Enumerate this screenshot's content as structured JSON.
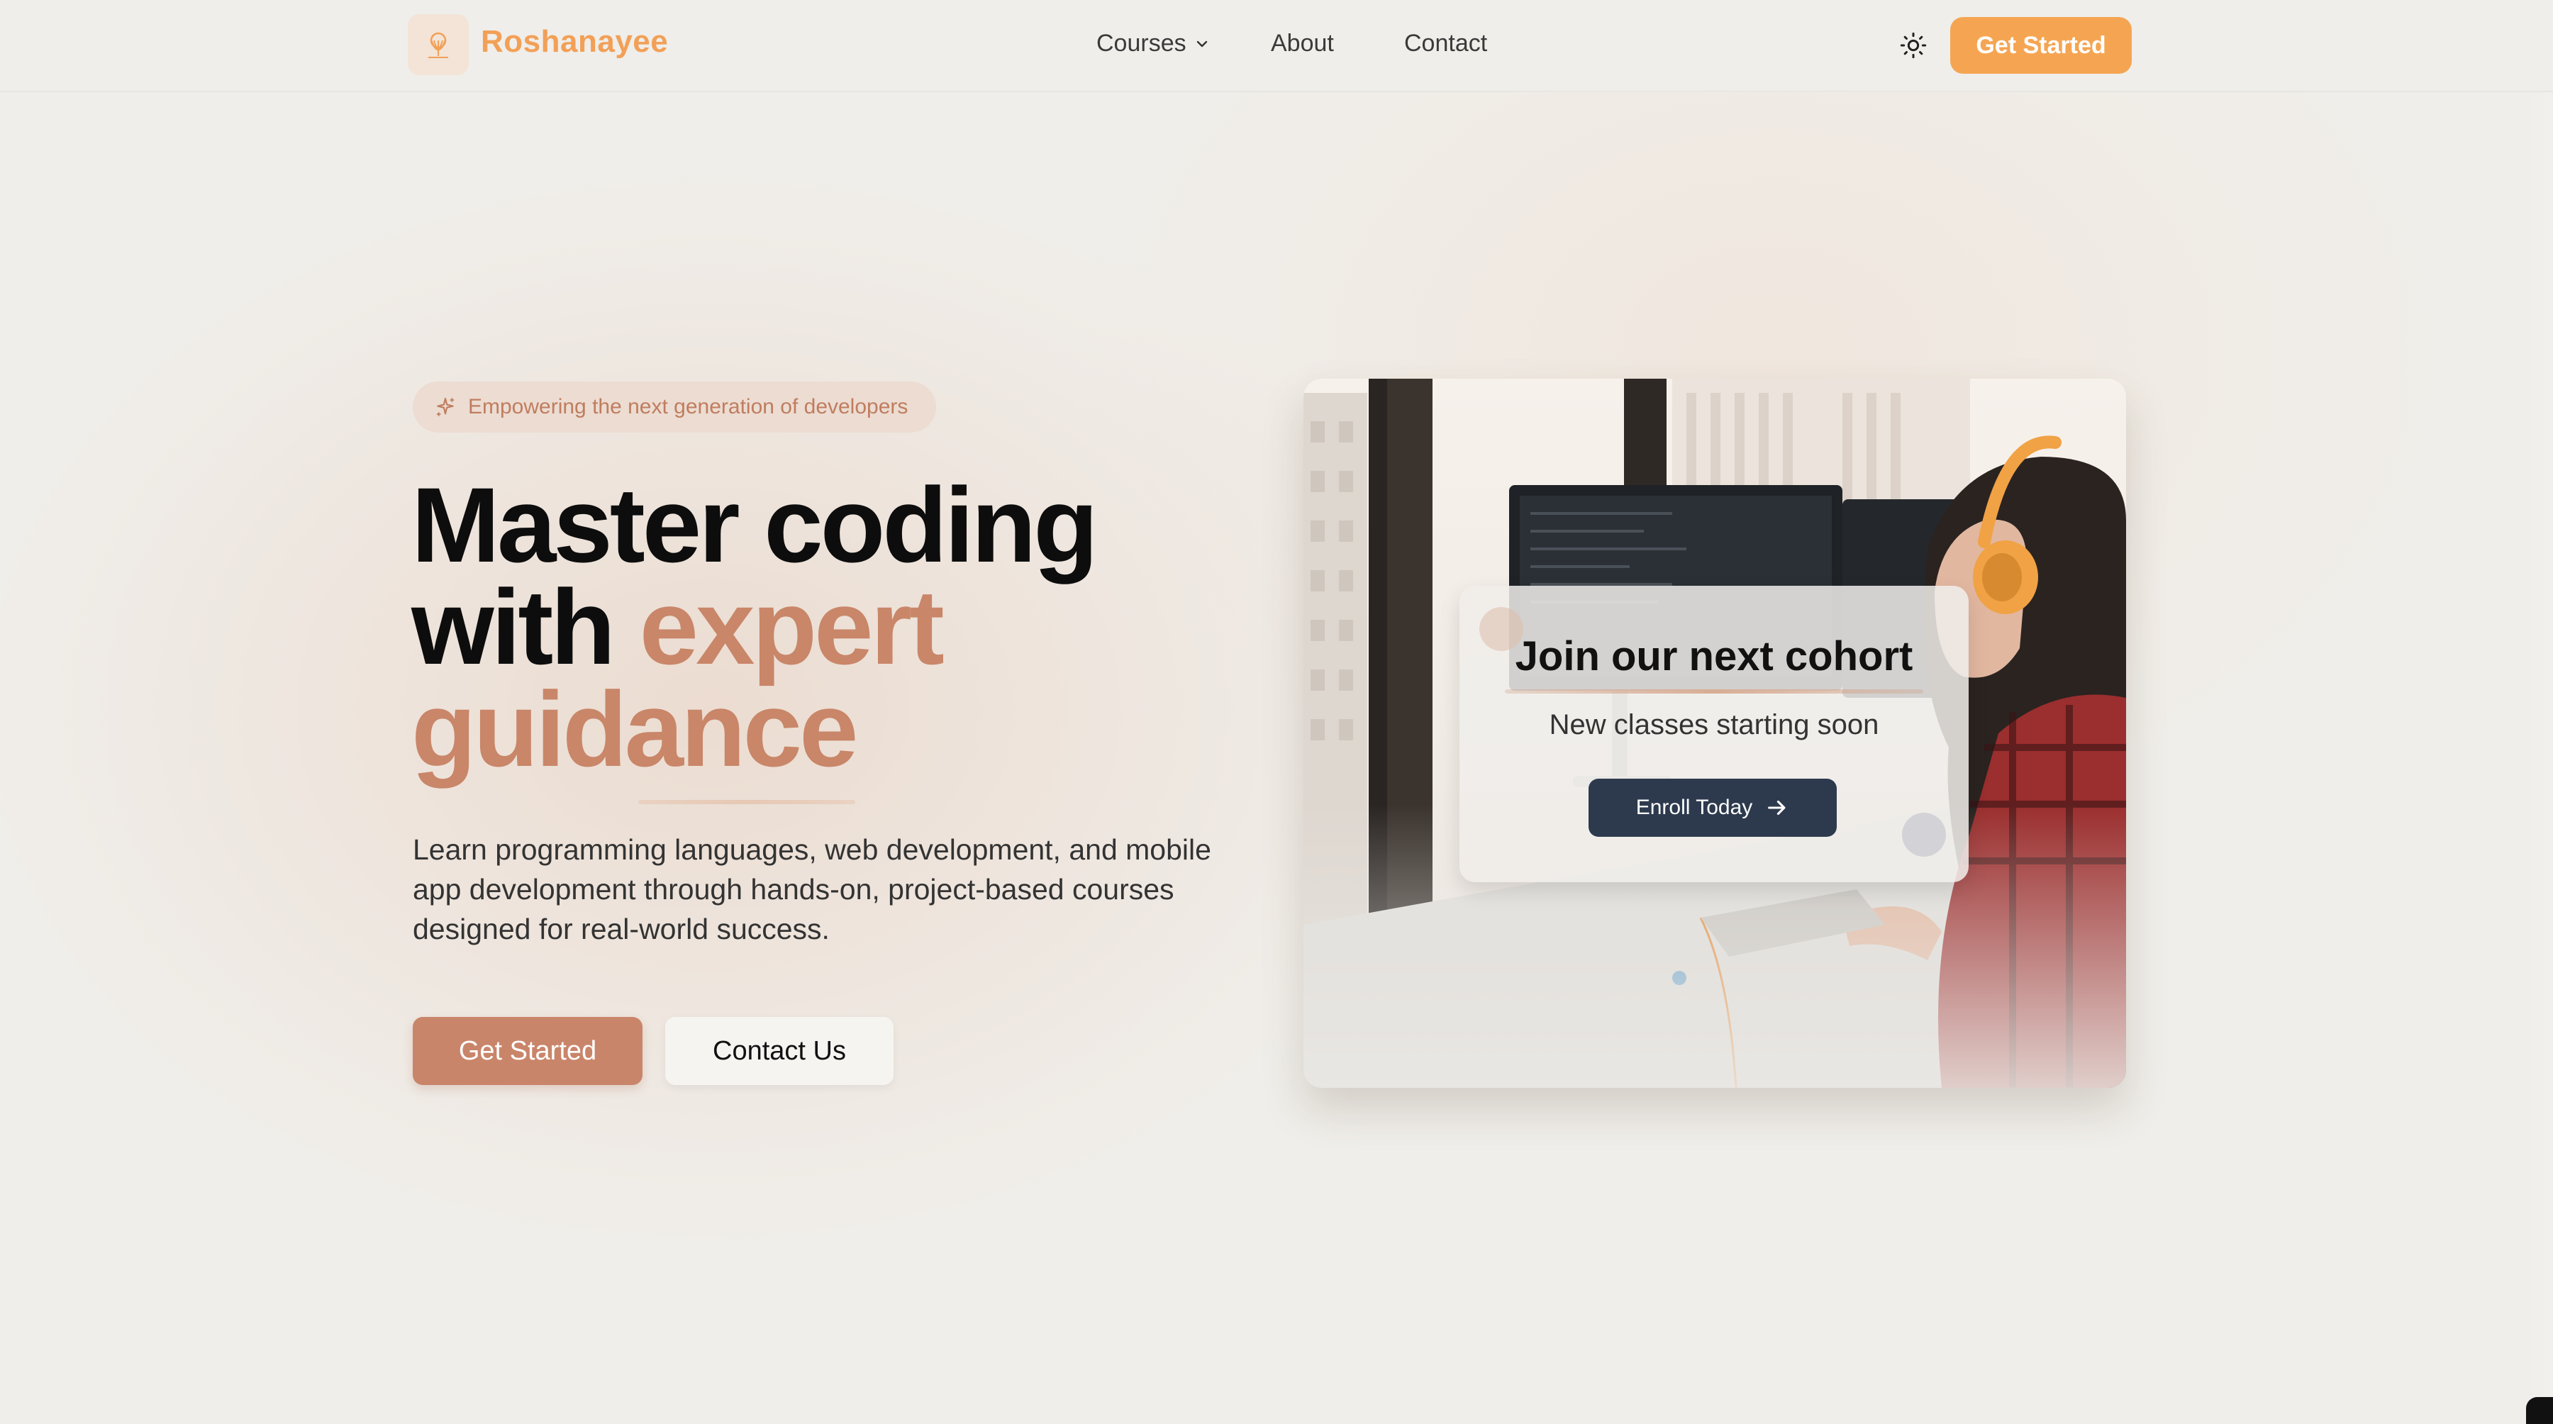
{
  "nav": {
    "brand": "Roshanayee",
    "links": [
      {
        "label": "Courses",
        "has_dropdown": true
      },
      {
        "label": "About"
      },
      {
        "label": "Contact"
      }
    ],
    "theme_icon": "sun-icon",
    "cta_label": "Get Started"
  },
  "hero": {
    "tagline": "Empowering the next generation of developers",
    "headline_line1": "Master coding",
    "headline_line2_plain": "with ",
    "headline_line2_accent": "expert",
    "headline_line3_accent": "guidance",
    "description": "Learn programming languages, web development, and mobile app development through hands-on, project-based courses designed for real-world success.",
    "primary_button": "Get Started",
    "secondary_button": "Contact Us"
  },
  "cohort_card": {
    "title": "Join our next cohort",
    "subtitle": "New classes starting soon",
    "button_label": "Enroll Today"
  },
  "colors": {
    "brand_orange": "#f2a057",
    "accent_terracotta": "#c9856a",
    "enroll_navy": "#2d3a4e",
    "background": "#f0eeea"
  }
}
